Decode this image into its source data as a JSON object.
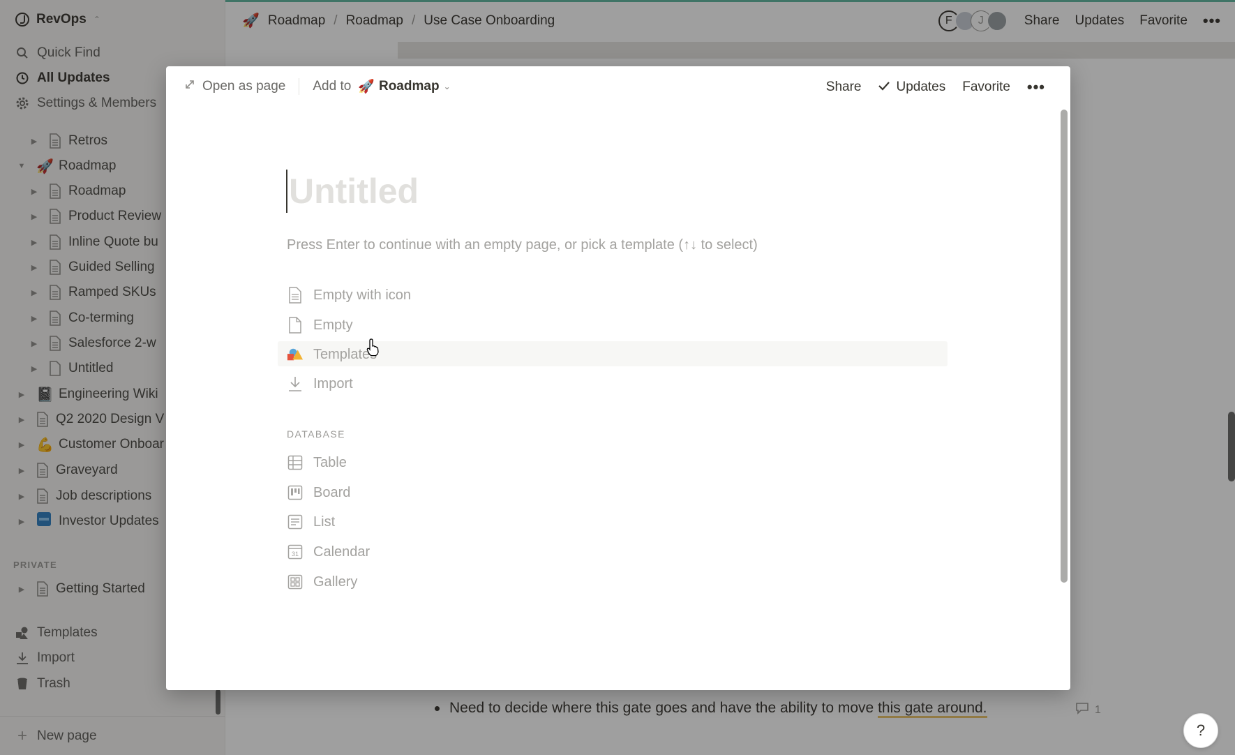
{
  "sidebar": {
    "workspace": "RevOps",
    "top_items": [
      {
        "label": "Quick Find",
        "icon": "search-icon"
      },
      {
        "label": "All Updates",
        "icon": "clock-icon"
      },
      {
        "label": "Settings & Members",
        "icon": "gear-icon"
      }
    ],
    "tree": [
      {
        "label": "Retros",
        "icon": "page-icon"
      },
      {
        "label": "Roadmap",
        "icon": "rocket-emoji"
      },
      {
        "label": "Roadmap",
        "icon": "page-icon"
      },
      {
        "label": "Product Review",
        "icon": "page-icon"
      },
      {
        "label": "Inline Quote bu",
        "icon": "page-icon"
      },
      {
        "label": "Guided Selling",
        "icon": "page-icon"
      },
      {
        "label": "Ramped SKUs",
        "icon": "page-icon"
      },
      {
        "label": "Co-terming",
        "icon": "page-icon"
      },
      {
        "label": "Salesforce 2-w",
        "icon": "page-icon"
      },
      {
        "label": "Untitled",
        "icon": "blank-page-icon"
      },
      {
        "label": "Engineering Wiki",
        "icon": "notebook-emoji"
      },
      {
        "label": "Q2 2020 Design V",
        "icon": "page-icon"
      },
      {
        "label": "Customer Onboar",
        "icon": "flexed-biceps-emoji"
      },
      {
        "label": "Graveyard",
        "icon": "page-icon"
      },
      {
        "label": "Job descriptions",
        "icon": "page-icon"
      },
      {
        "label": "Investor Updates",
        "icon": "investor-image-icon"
      }
    ],
    "private_label": "PRIVATE",
    "private_items": [
      {
        "label": "Getting Started",
        "icon": "page-icon"
      }
    ],
    "bottom_items": [
      {
        "label": "Templates",
        "icon": "shapes-icon"
      },
      {
        "label": "Import",
        "icon": "import-icon"
      },
      {
        "label": "Trash",
        "icon": "trash-icon"
      }
    ],
    "new_page": "New page"
  },
  "topbar": {
    "breadcrumbs": [
      "Roadmap",
      "Roadmap",
      "Use Case Onboarding"
    ],
    "separator": "/",
    "avatars": [
      "F",
      "J"
    ],
    "share": "Share",
    "updates": "Updates",
    "favorite": "Favorite",
    "more": "•••"
  },
  "background": {
    "bullet_text": "Need to decide where this gate goes and have the ability to move ",
    "bullet_highlight": "this gate around.",
    "comment_count": "1",
    "help": "?"
  },
  "modal": {
    "open_as_page": "Open as page",
    "add_to": "Add to",
    "add_to_target": "Roadmap",
    "share": "Share",
    "updates": "Updates",
    "favorite": "Favorite",
    "more": "•••",
    "title_placeholder": "Untitled",
    "hint": "Press Enter to continue with an empty page, or pick a template (↑↓ to select)",
    "options": [
      {
        "label": "Empty with icon",
        "icon": "page-with-lines-icon"
      },
      {
        "label": "Empty",
        "icon": "blank-page-icon"
      },
      {
        "label": "Templates",
        "icon": "shapes-icon"
      },
      {
        "label": "Import",
        "icon": "import-icon"
      }
    ],
    "database_label": "DATABASE",
    "database_options": [
      {
        "label": "Table",
        "icon": "table-icon"
      },
      {
        "label": "Board",
        "icon": "board-icon"
      },
      {
        "label": "List",
        "icon": "list-icon"
      },
      {
        "label": "Calendar",
        "icon": "calendar-icon"
      },
      {
        "label": "Gallery",
        "icon": "gallery-icon"
      }
    ],
    "calendar_icon_text": "31"
  },
  "colors": {
    "accent_topbar": "#5fb7a1",
    "text": "#37352f",
    "muted": "#a3a29f",
    "sidebar_bg": "#f7f6f3",
    "highlight_underline": "#e9c46a"
  }
}
